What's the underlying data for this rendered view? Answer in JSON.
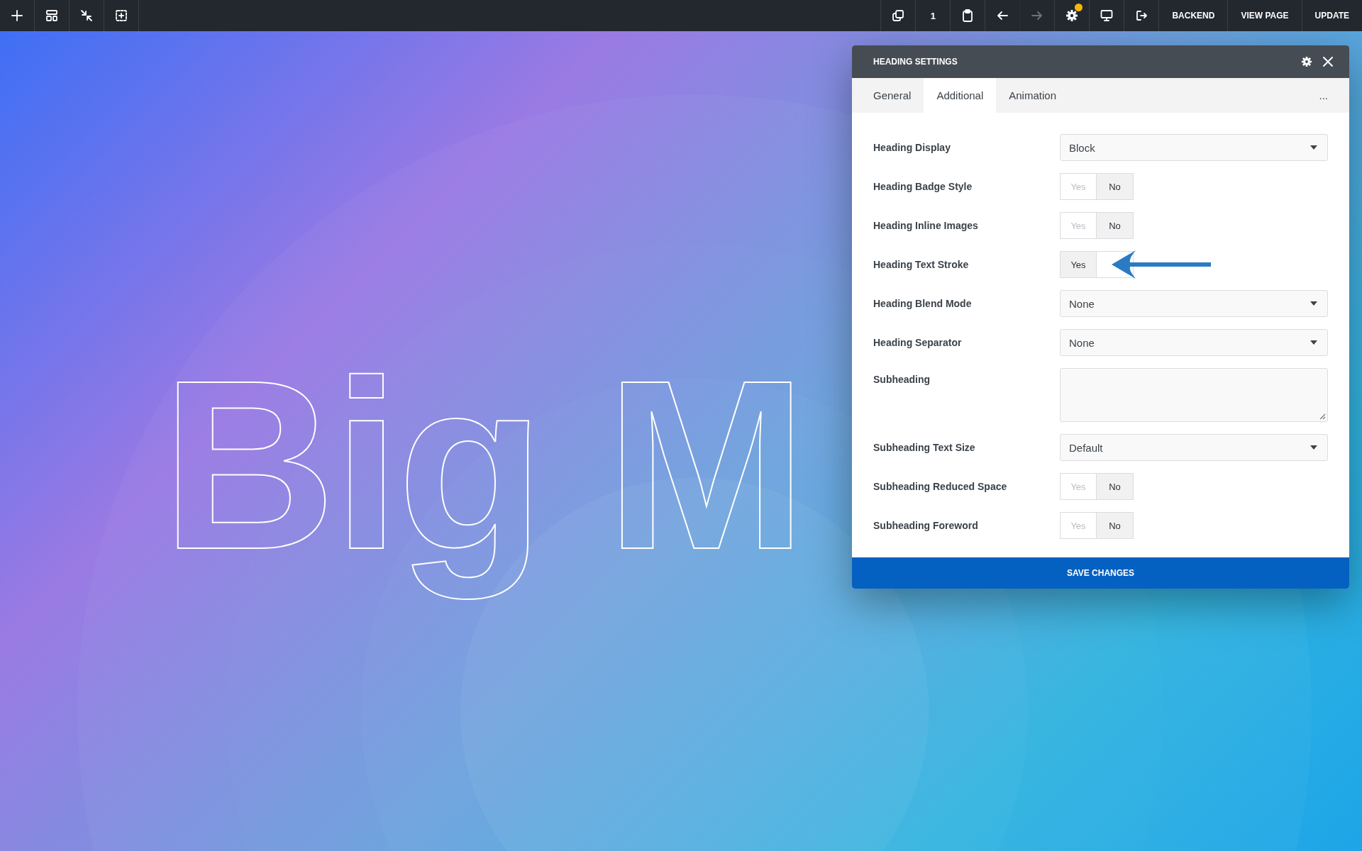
{
  "toolbar": {
    "left_tools": [
      {
        "kind": "add"
      },
      {
        "kind": "layout"
      },
      {
        "kind": "collapse"
      },
      {
        "kind": "add-section"
      }
    ],
    "right_tools": [
      {
        "kind": "duplicate"
      },
      {
        "kind": "text",
        "label": "1"
      },
      {
        "kind": "clipboard"
      },
      {
        "kind": "undo"
      },
      {
        "kind": "redo",
        "disabled": true
      },
      {
        "kind": "settings",
        "notification": true
      },
      {
        "kind": "monitor"
      },
      {
        "kind": "exit"
      },
      {
        "kind": "text",
        "label": "BACKEND"
      },
      {
        "kind": "text",
        "label": "VIEW PAGE"
      },
      {
        "kind": "text",
        "label": "UPDATE"
      }
    ]
  },
  "canvas": {
    "heading": "Big M"
  },
  "panel": {
    "title": "HEADING SETTINGS",
    "tabs": [
      {
        "label": "General",
        "selected": false
      },
      {
        "label": "Additional",
        "selected": true
      },
      {
        "label": "Animation",
        "selected": false
      }
    ],
    "more": "...",
    "fields": [
      {
        "kind": "select",
        "label": "Heading Display",
        "value": "Block"
      },
      {
        "kind": "toggle",
        "label": "Heading Badge Style",
        "yes": "Yes",
        "no": "No",
        "on": false
      },
      {
        "kind": "toggle",
        "label": "Heading Inline Images",
        "yes": "Yes",
        "no": "No",
        "on": false
      },
      {
        "kind": "toggle",
        "label": "Heading Text Stroke",
        "yes": "Yes",
        "on": true,
        "annotated": true
      },
      {
        "kind": "select",
        "label": "Heading Blend Mode",
        "value": "None"
      },
      {
        "kind": "select",
        "label": "Heading Separator",
        "value": "None"
      },
      {
        "kind": "textarea",
        "label": "Subheading"
      },
      {
        "kind": "select",
        "label": "Subheading Text Size",
        "value": "Default"
      },
      {
        "kind": "toggle",
        "label": "Subheading Reduced Space",
        "yes": "Yes",
        "no": "No",
        "on": false
      },
      {
        "kind": "toggle",
        "label": "Subheading Foreword",
        "yes": "Yes",
        "no": "No",
        "on": false
      }
    ],
    "save_button": "SAVE CHANGES"
  }
}
